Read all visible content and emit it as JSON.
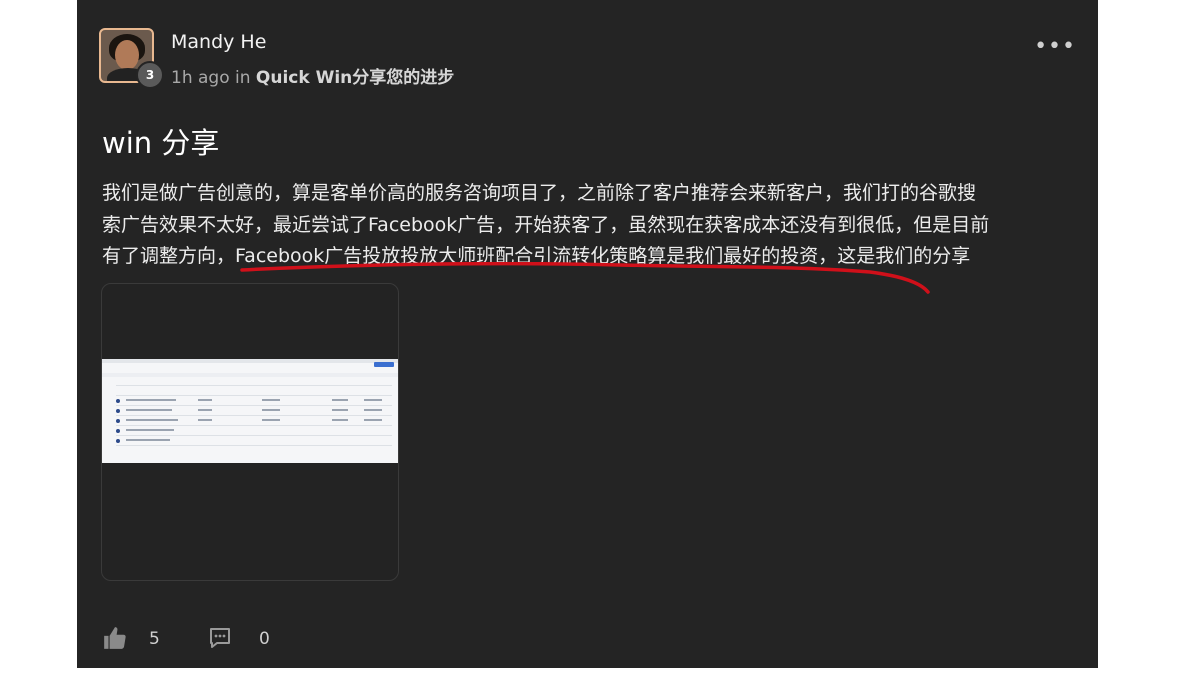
{
  "post": {
    "author": {
      "name": "Mandy He",
      "level": "3"
    },
    "meta": {
      "time": "1h ago",
      "in_word": "in",
      "group": "Quick Win分享您的进步"
    },
    "more_label": "•••",
    "title": "win 分享",
    "body_line1": "我们是做广告创意的，算是客单价高的服务咨询项目了，之前除了客户推荐会来新客户，我们打的谷歌搜",
    "body_line2": "索广告效果不太好，最近尝试了Facebook广告，开始获客了，虽然现在获客成本还没有到很低，但是目前",
    "body_line3": "有了调整方向，Facebook广告投放投放大师班配合引流转化策略算是我们最好的投资，这是我们的分享",
    "annotation_color": "#d0101a"
  },
  "reactions": {
    "likes": "5",
    "comments": "0"
  },
  "icons": {
    "like": "thumbs-up-icon",
    "comment": "comment-icon",
    "more": "more-icon"
  }
}
